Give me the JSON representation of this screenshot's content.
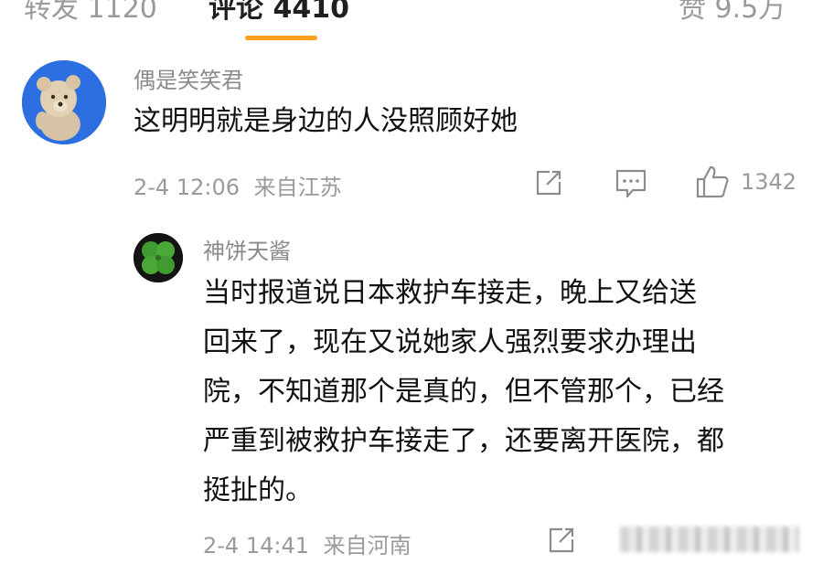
{
  "tabs": [
    {
      "label": "转发 1120"
    },
    {
      "label": "评论 4410"
    },
    {
      "label": "赞 9.5万"
    }
  ],
  "comment": {
    "username": "偶是笑笑君",
    "text": "这明明就是身边的人没照顾好她",
    "time": "2-4 12:06",
    "location": "来自江苏",
    "like_count": "1342"
  },
  "reply": {
    "username": "神饼天酱",
    "lines": [
      "当时报道说日本救护车接走，晚上又给送",
      "回来了，现在又说她家人强烈要求办理出",
      "院，不知道那个是真的，但不管那个，已经",
      "严重到被救护车接走了，还要离开医院，都",
      "挺扯的。"
    ],
    "time": "2-4 14:41",
    "location": "来自河南"
  },
  "icons": {
    "share": "share-icon",
    "comment": "comment-icon",
    "like": "thumbs-up-icon"
  },
  "colors": {
    "tab_indicator": "#ff9e1b",
    "secondary_text": "#9a9a9a",
    "primary_text": "#111111"
  }
}
